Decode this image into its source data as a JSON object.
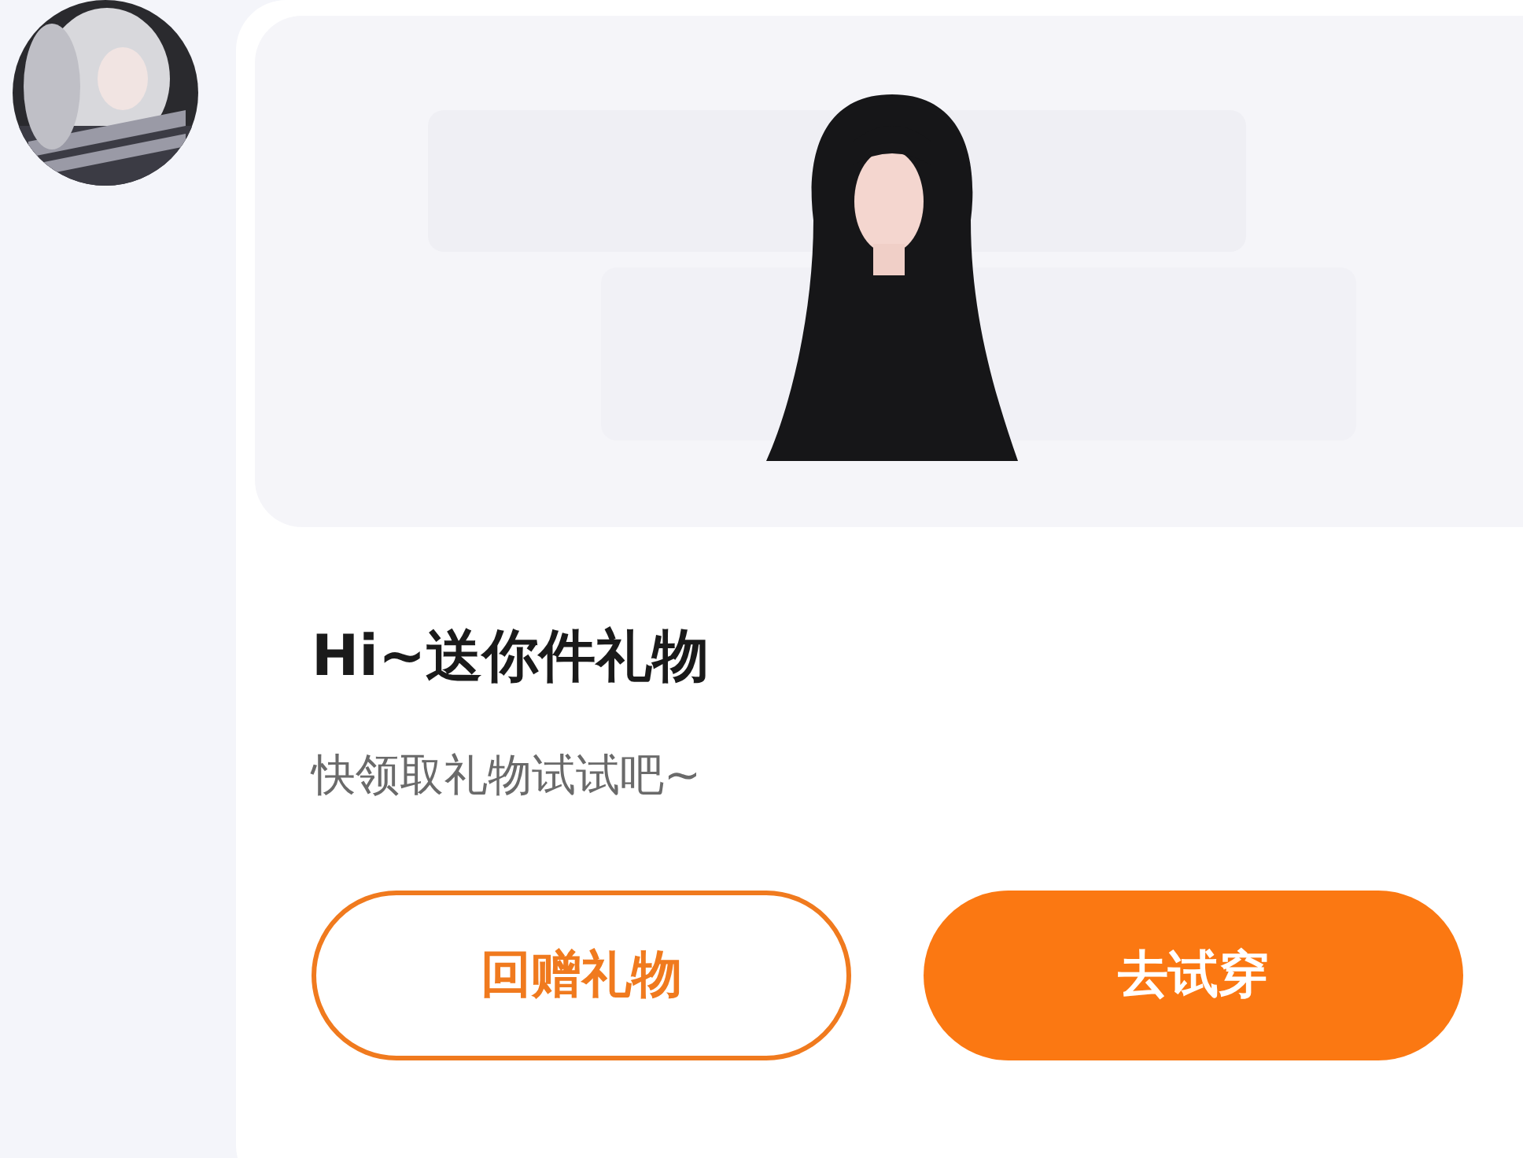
{
  "message_card": {
    "title": "Hi~送你件礼物",
    "subtitle": "快领取礼物试试吧~",
    "buttons": [
      {
        "label": "回赠礼物",
        "kind": "outline"
      },
      {
        "label": "去试穿",
        "kind": "filled"
      }
    ]
  }
}
